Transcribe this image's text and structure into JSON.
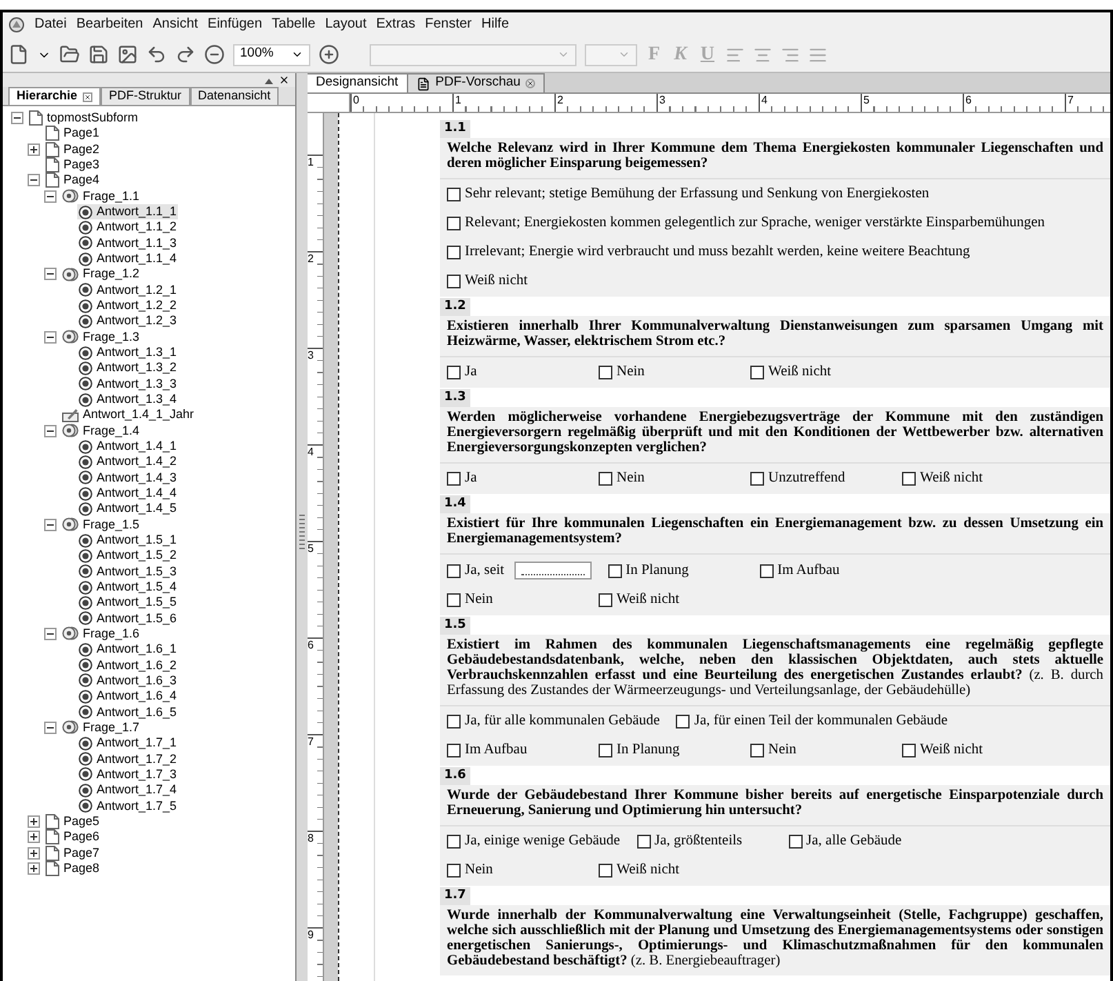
{
  "menu": [
    "Datei",
    "Bearbeiten",
    "Ansicht",
    "Einfügen",
    "Tabelle",
    "Layout",
    "Extras",
    "Fenster",
    "Hilfe"
  ],
  "toolbar": {
    "zoom": "100%",
    "format_buttons": [
      {
        "label": "F",
        "disabled": true
      },
      {
        "label": "K",
        "disabled": true
      },
      {
        "label": "U",
        "disabled": true
      }
    ]
  },
  "left_panel": {
    "tabs": [
      {
        "label": "Hierarchie",
        "selected": true,
        "closable": true
      },
      {
        "label": "PDF-Struktur",
        "selected": false,
        "closable": false
      },
      {
        "label": "Datenansicht",
        "selected": false,
        "closable": false
      }
    ],
    "tree": [
      {
        "label": "topmostSubform",
        "kind": "page",
        "selected": false,
        "expanded": true,
        "children": [
          {
            "label": "Page1",
            "kind": "page",
            "selected": false
          },
          {
            "label": "Page2",
            "kind": "page",
            "selected": false,
            "expanded": false
          },
          {
            "label": "Page3",
            "kind": "page",
            "selected": false
          },
          {
            "label": "Page4",
            "kind": "page",
            "selected": false,
            "expanded": true,
            "children": [
              {
                "label": "Frage_1.1",
                "kind": "radio-group",
                "selected": false,
                "expanded": true,
                "children": [
                  {
                    "label": "Antwort_1.1_1",
                    "kind": "radio",
                    "selected": true
                  },
                  {
                    "label": "Antwort_1.1_2",
                    "kind": "radio",
                    "selected": false
                  },
                  {
                    "label": "Antwort_1.1_3",
                    "kind": "radio",
                    "selected": false
                  },
                  {
                    "label": "Antwort_1.1_4",
                    "kind": "radio",
                    "selected": false
                  }
                ]
              },
              {
                "label": "Frage_1.2",
                "kind": "radio-group",
                "selected": false,
                "expanded": true,
                "children": [
                  {
                    "label": "Antwort_1.2_1",
                    "kind": "radio",
                    "selected": false
                  },
                  {
                    "label": "Antwort_1.2_2",
                    "kind": "radio",
                    "selected": false
                  },
                  {
                    "label": "Antwort_1.2_3",
                    "kind": "radio",
                    "selected": false
                  }
                ]
              },
              {
                "label": "Frage_1.3",
                "kind": "radio-group",
                "selected": false,
                "expanded": true,
                "children": [
                  {
                    "label": "Antwort_1.3_1",
                    "kind": "radio",
                    "selected": false
                  },
                  {
                    "label": "Antwort_1.3_2",
                    "kind": "radio",
                    "selected": false
                  },
                  {
                    "label": "Antwort_1.3_3",
                    "kind": "radio",
                    "selected": false
                  },
                  {
                    "label": "Antwort_1.3_4",
                    "kind": "radio",
                    "selected": false
                  }
                ]
              },
              {
                "label": "Antwort_1.4_1_Jahr",
                "kind": "text-field",
                "selected": false
              },
              {
                "label": "Frage_1.4",
                "kind": "radio-group",
                "selected": false,
                "expanded": true,
                "children": [
                  {
                    "label": "Antwort_1.4_1",
                    "kind": "radio",
                    "selected": false
                  },
                  {
                    "label": "Antwort_1.4_2",
                    "kind": "radio",
                    "selected": false
                  },
                  {
                    "label": "Antwort_1.4_3",
                    "kind": "radio",
                    "selected": false
                  },
                  {
                    "label": "Antwort_1.4_4",
                    "kind": "radio",
                    "selected": false
                  },
                  {
                    "label": "Antwort_1.4_5",
                    "kind": "radio",
                    "selected": false
                  }
                ]
              },
              {
                "label": "Frage_1.5",
                "kind": "radio-group",
                "selected": false,
                "expanded": true,
                "children": [
                  {
                    "label": "Antwort_1.5_1",
                    "kind": "radio",
                    "selected": false
                  },
                  {
                    "label": "Antwort_1.5_2",
                    "kind": "radio",
                    "selected": false
                  },
                  {
                    "label": "Antwort_1.5_3",
                    "kind": "radio",
                    "selected": false
                  },
                  {
                    "label": "Antwort_1.5_4",
                    "kind": "radio",
                    "selected": false
                  },
                  {
                    "label": "Antwort_1.5_5",
                    "kind": "radio",
                    "selected": false
                  },
                  {
                    "label": "Antwort_1.5_6",
                    "kind": "radio",
                    "selected": false
                  }
                ]
              },
              {
                "label": "Frage_1.6",
                "kind": "radio-group",
                "selected": false,
                "expanded": true,
                "children": [
                  {
                    "label": "Antwort_1.6_1",
                    "kind": "radio",
                    "selected": false
                  },
                  {
                    "label": "Antwort_1.6_2",
                    "kind": "radio",
                    "selected": false
                  },
                  {
                    "label": "Antwort_1.6_3",
                    "kind": "radio",
                    "selected": false
                  },
                  {
                    "label": "Antwort_1.6_4",
                    "kind": "radio",
                    "selected": false
                  },
                  {
                    "label": "Antwort_1.6_5",
                    "kind": "radio",
                    "selected": false
                  }
                ]
              },
              {
                "label": "Frage_1.7",
                "kind": "radio-group",
                "selected": false,
                "expanded": true,
                "children": [
                  {
                    "label": "Antwort_1.7_1",
                    "kind": "radio",
                    "selected": false
                  },
                  {
                    "label": "Antwort_1.7_2",
                    "kind": "radio",
                    "selected": false
                  },
                  {
                    "label": "Antwort_1.7_3",
                    "kind": "radio",
                    "selected": false
                  },
                  {
                    "label": "Antwort_1.7_4",
                    "kind": "radio",
                    "selected": false
                  },
                  {
                    "label": "Antwort_1.7_5",
                    "kind": "radio",
                    "selected": false
                  }
                ]
              }
            ]
          },
          {
            "label": "Page5",
            "kind": "page",
            "selected": false,
            "expanded": false
          },
          {
            "label": "Page6",
            "kind": "page",
            "selected": false,
            "expanded": false
          },
          {
            "label": "Page7",
            "kind": "page",
            "selected": false,
            "expanded": false
          },
          {
            "label": "Page8",
            "kind": "page",
            "selected": false,
            "expanded": false
          }
        ]
      }
    ]
  },
  "doc_tabs": [
    {
      "label": "Designansicht",
      "kind": "design",
      "selected": true,
      "closable": false
    },
    {
      "label": "PDF-Vorschau",
      "kind": "pdf",
      "selected": false,
      "closable": true
    }
  ],
  "ruler": {
    "horizontal": [
      "0",
      "1",
      "2",
      "3",
      "4",
      "5",
      "6",
      "7"
    ],
    "vertical": [
      "1",
      "2",
      "3",
      "4",
      "5",
      "6",
      "7",
      "8",
      "9"
    ]
  },
  "questions": [
    {
      "number": "1.1",
      "text": "Welche Relevanz wird in Ihrer Kommune dem Thema Energiekosten kommunaler Liegenschaften und deren möglicher Einsparung beigemessen?",
      "option_rows": [
        [
          {
            "label": "Sehr relevant; stetige Bemühung der Erfassung und Senkung von Energiekosten",
            "kind": "checkbox",
            "checked": false
          }
        ],
        [
          {
            "label": "Relevant; Energiekosten kommen gelegentlich zur Sprache, weniger verstärkte Einsparbemühungen",
            "kind": "checkbox",
            "checked": false
          }
        ],
        [
          {
            "label": "Irrelevant; Energie wird verbraucht und muss bezahlt werden, keine weitere Beachtung",
            "kind": "checkbox",
            "checked": false
          }
        ],
        [
          {
            "label": "Weiß nicht",
            "kind": "checkbox",
            "checked": false
          }
        ]
      ]
    },
    {
      "number": "1.2",
      "text": "Existieren innerhalb Ihrer Kommunalverwaltung Dienstanweisungen zum sparsamen Umgang mit Heizwärme, Wasser, elektrischem Strom etc.?",
      "option_rows": [
        [
          {
            "label": "Ja",
            "kind": "checkbox",
            "checked": false
          },
          {
            "label": "Nein",
            "kind": "checkbox",
            "checked": false
          },
          {
            "label": "Weiß nicht",
            "kind": "checkbox",
            "checked": false
          }
        ]
      ]
    },
    {
      "number": "1.3",
      "text": "Werden möglicherweise vorhandene Energiebezugsverträge der Kommune mit den zuständigen Energieversorgern regelmäßig überprüft und mit den Konditionen der Wettbewerber bzw. alternativen Energieversorgungskonzepten verglichen?",
      "option_rows": [
        [
          {
            "label": "Ja",
            "kind": "checkbox",
            "checked": false
          },
          {
            "label": "Nein",
            "kind": "checkbox",
            "checked": false
          },
          {
            "label": "Unzutreffend",
            "kind": "checkbox",
            "checked": false
          },
          {
            "label": "Weiß nicht",
            "kind": "checkbox",
            "checked": false
          }
        ]
      ]
    },
    {
      "number": "1.4",
      "text": "Existiert für Ihre kommunalen Liegenschaften ein Energiemanagement bzw. zu dessen Umsetzung ein Energiemanagementsystem?",
      "option_rows": [
        [
          {
            "label": "Ja, seit",
            "kind": "checkbox-field",
            "checked": false
          },
          {
            "label": "In Planung",
            "kind": "checkbox",
            "checked": false
          },
          {
            "label": "Im Aufbau",
            "kind": "checkbox",
            "checked": false
          }
        ],
        [
          {
            "label": "Nein",
            "kind": "checkbox",
            "checked": false
          },
          {
            "label": "Weiß nicht",
            "kind": "checkbox",
            "checked": false
          }
        ]
      ]
    },
    {
      "number": "1.5",
      "text": "Existiert im Rahmen des kommunalen Liegenschaftsmanagements eine regelmäßig gepflegte Gebäudebestandsdatenbank, welche, neben den klassischen Objektdaten, auch stets aktuelle Verbrauchskennzahlen erfasst und eine Beurteilung des energetischen Zustandes erlaubt?",
      "note": "(z. B. durch Erfassung des Zustandes der Wärmeerzeugungs- und Verteilungsanlage, der Gebäudehülle)",
      "option_rows": [
        [
          {
            "label": "Ja, für alle kommunalen Gebäude",
            "kind": "checkbox",
            "checked": false
          },
          {
            "label": "Ja, für einen Teil der kommunalen Gebäude",
            "kind": "checkbox",
            "checked": false
          }
        ],
        [
          {
            "label": "Im Aufbau",
            "kind": "checkbox",
            "checked": false
          },
          {
            "label": "In Planung",
            "kind": "checkbox",
            "checked": false
          },
          {
            "label": "Nein",
            "kind": "checkbox",
            "checked": false
          },
          {
            "label": "Weiß nicht",
            "kind": "checkbox",
            "checked": false
          }
        ]
      ]
    },
    {
      "number": "1.6",
      "text": "Wurde der Gebäudebestand Ihrer Kommune bisher bereits auf energetische Einsparpotenziale durch Erneuerung, Sanierung und Optimierung hin untersucht?",
      "option_rows": [
        [
          {
            "label": "Ja, einige wenige Gebäude",
            "kind": "checkbox",
            "checked": false
          },
          {
            "label": "Ja, größtenteils",
            "kind": "checkbox",
            "checked": false
          },
          {
            "label": "Ja, alle Gebäude",
            "kind": "checkbox",
            "checked": false
          }
        ],
        [
          {
            "label": "Nein",
            "kind": "checkbox",
            "checked": false
          },
          {
            "label": "Weiß nicht",
            "kind": "checkbox",
            "checked": false
          }
        ]
      ]
    },
    {
      "number": "1.7",
      "text": "Wurde innerhalb der Kommunalverwaltung eine Verwaltungseinheit (Stelle, Fachgruppe) geschaffen, welche sich ausschließlich mit der Planung und Umsetzung des Energiemanagementsystems oder sonstigen energetischen Sanierungs-, Optimierungs- und Klimaschutzmaßnahmen für den kommunalen Gebäudebestand beschäftigt?",
      "note": "(z. B. Energiebeauftrager)"
    }
  ]
}
